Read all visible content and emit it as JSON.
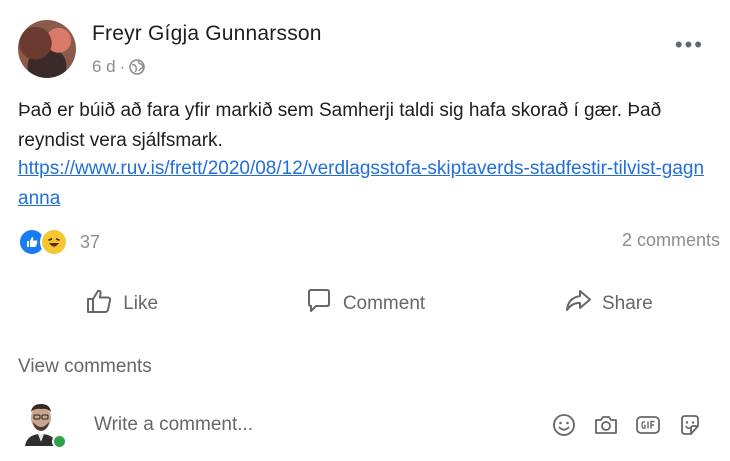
{
  "post": {
    "author": "Freyr Gígja Gunnarsson",
    "time": "6 d",
    "privacy_separator": "·",
    "text": "Það er búið að fara yfir markið sem Samherji taldi sig hafa skorað í gær. Það reyndist vera sjálfsmark.",
    "link": "https://www.ruv.is/frett/2020/08/12/verdlagsstofa-skiptaverds-stadfestir-tilvist-gagnanna",
    "more": "•••"
  },
  "reactions": {
    "count": "37",
    "types": [
      "like-icon",
      "haha-icon"
    ],
    "comments_label": "2 comments"
  },
  "actions": {
    "like": "Like",
    "comment": "Comment",
    "share": "Share"
  },
  "comments": {
    "view_label": "View comments",
    "placeholder": "Write a comment...",
    "tools": [
      "emoji-icon",
      "camera-icon",
      "gif-icon",
      "sticker-icon"
    ]
  },
  "colors": {
    "link": "#216fdb",
    "like": "#1a7cf3",
    "haha": "#f7c631",
    "online": "#31a24c"
  }
}
